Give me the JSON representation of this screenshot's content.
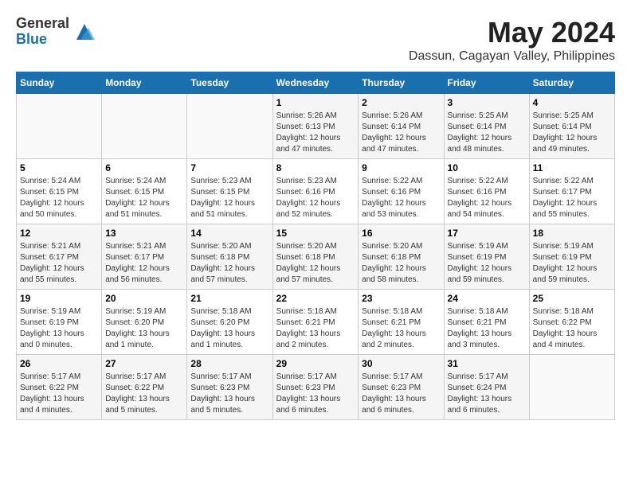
{
  "logo": {
    "general": "General",
    "blue": "Blue"
  },
  "title": {
    "month_year": "May 2024",
    "location": "Dassun, Cagayan Valley, Philippines"
  },
  "calendar": {
    "headers": [
      "Sunday",
      "Monday",
      "Tuesday",
      "Wednesday",
      "Thursday",
      "Friday",
      "Saturday"
    ],
    "rows": [
      [
        {
          "day": "",
          "info": ""
        },
        {
          "day": "",
          "info": ""
        },
        {
          "day": "",
          "info": ""
        },
        {
          "day": "1",
          "info": "Sunrise: 5:26 AM\nSunset: 6:13 PM\nDaylight: 12 hours and 47 minutes."
        },
        {
          "day": "2",
          "info": "Sunrise: 5:26 AM\nSunset: 6:14 PM\nDaylight: 12 hours and 47 minutes."
        },
        {
          "day": "3",
          "info": "Sunrise: 5:25 AM\nSunset: 6:14 PM\nDaylight: 12 hours and 48 minutes."
        },
        {
          "day": "4",
          "info": "Sunrise: 5:25 AM\nSunset: 6:14 PM\nDaylight: 12 hours and 49 minutes."
        }
      ],
      [
        {
          "day": "5",
          "info": "Sunrise: 5:24 AM\nSunset: 6:15 PM\nDaylight: 12 hours and 50 minutes."
        },
        {
          "day": "6",
          "info": "Sunrise: 5:24 AM\nSunset: 6:15 PM\nDaylight: 12 hours and 51 minutes."
        },
        {
          "day": "7",
          "info": "Sunrise: 5:23 AM\nSunset: 6:15 PM\nDaylight: 12 hours and 51 minutes."
        },
        {
          "day": "8",
          "info": "Sunrise: 5:23 AM\nSunset: 6:16 PM\nDaylight: 12 hours and 52 minutes."
        },
        {
          "day": "9",
          "info": "Sunrise: 5:22 AM\nSunset: 6:16 PM\nDaylight: 12 hours and 53 minutes."
        },
        {
          "day": "10",
          "info": "Sunrise: 5:22 AM\nSunset: 6:16 PM\nDaylight: 12 hours and 54 minutes."
        },
        {
          "day": "11",
          "info": "Sunrise: 5:22 AM\nSunset: 6:17 PM\nDaylight: 12 hours and 55 minutes."
        }
      ],
      [
        {
          "day": "12",
          "info": "Sunrise: 5:21 AM\nSunset: 6:17 PM\nDaylight: 12 hours and 55 minutes."
        },
        {
          "day": "13",
          "info": "Sunrise: 5:21 AM\nSunset: 6:17 PM\nDaylight: 12 hours and 56 minutes."
        },
        {
          "day": "14",
          "info": "Sunrise: 5:20 AM\nSunset: 6:18 PM\nDaylight: 12 hours and 57 minutes."
        },
        {
          "day": "15",
          "info": "Sunrise: 5:20 AM\nSunset: 6:18 PM\nDaylight: 12 hours and 57 minutes."
        },
        {
          "day": "16",
          "info": "Sunrise: 5:20 AM\nSunset: 6:18 PM\nDaylight: 12 hours and 58 minutes."
        },
        {
          "day": "17",
          "info": "Sunrise: 5:19 AM\nSunset: 6:19 PM\nDaylight: 12 hours and 59 minutes."
        },
        {
          "day": "18",
          "info": "Sunrise: 5:19 AM\nSunset: 6:19 PM\nDaylight: 12 hours and 59 minutes."
        }
      ],
      [
        {
          "day": "19",
          "info": "Sunrise: 5:19 AM\nSunset: 6:19 PM\nDaylight: 13 hours and 0 minutes."
        },
        {
          "day": "20",
          "info": "Sunrise: 5:19 AM\nSunset: 6:20 PM\nDaylight: 13 hours and 1 minute."
        },
        {
          "day": "21",
          "info": "Sunrise: 5:18 AM\nSunset: 6:20 PM\nDaylight: 13 hours and 1 minutes."
        },
        {
          "day": "22",
          "info": "Sunrise: 5:18 AM\nSunset: 6:21 PM\nDaylight: 13 hours and 2 minutes."
        },
        {
          "day": "23",
          "info": "Sunrise: 5:18 AM\nSunset: 6:21 PM\nDaylight: 13 hours and 2 minutes."
        },
        {
          "day": "24",
          "info": "Sunrise: 5:18 AM\nSunset: 6:21 PM\nDaylight: 13 hours and 3 minutes."
        },
        {
          "day": "25",
          "info": "Sunrise: 5:18 AM\nSunset: 6:22 PM\nDaylight: 13 hours and 4 minutes."
        }
      ],
      [
        {
          "day": "26",
          "info": "Sunrise: 5:17 AM\nSunset: 6:22 PM\nDaylight: 13 hours and 4 minutes."
        },
        {
          "day": "27",
          "info": "Sunrise: 5:17 AM\nSunset: 6:22 PM\nDaylight: 13 hours and 5 minutes."
        },
        {
          "day": "28",
          "info": "Sunrise: 5:17 AM\nSunset: 6:23 PM\nDaylight: 13 hours and 5 minutes."
        },
        {
          "day": "29",
          "info": "Sunrise: 5:17 AM\nSunset: 6:23 PM\nDaylight: 13 hours and 6 minutes."
        },
        {
          "day": "30",
          "info": "Sunrise: 5:17 AM\nSunset: 6:23 PM\nDaylight: 13 hours and 6 minutes."
        },
        {
          "day": "31",
          "info": "Sunrise: 5:17 AM\nSunset: 6:24 PM\nDaylight: 13 hours and 6 minutes."
        },
        {
          "day": "",
          "info": ""
        }
      ]
    ]
  }
}
